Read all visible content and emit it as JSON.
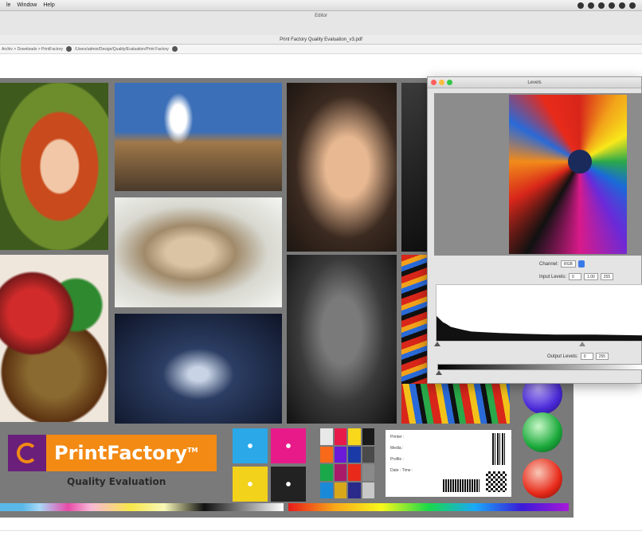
{
  "menubar": {
    "items": [
      "le",
      "Window",
      "Help"
    ]
  },
  "window": {
    "title_small": "Editor",
    "document_title": "Print Factory Quality Evaluation_v3.pdf"
  },
  "pathbar": {
    "left_path": "Archiv > Downloads > PrintFactory",
    "right_path": "/Users/admin/Design/Quality/Evaluation/Print Factory"
  },
  "chart_labels": {
    "brand": "PrintFactory",
    "trademark": "TM",
    "subtitle": "Quality Evaluation",
    "form_fields": [
      "Printer :",
      "Media :",
      "Profile :",
      "Date :",
      "Time :"
    ]
  },
  "levels": {
    "title": "Levels",
    "channel_label": "Channel:",
    "channel_value": "RGB",
    "input_label": "Input Levels:",
    "input_values": [
      "0",
      "1.00",
      "255"
    ],
    "output_label": "Output Levels:",
    "output_values": [
      "0",
      "255"
    ]
  },
  "colors": {
    "brand_orange": "#f28a14",
    "brand_purple": "#6a1f7a",
    "canvas_gray": "#7a7a7a"
  },
  "icons": [
    "apple-menu-icon",
    "status-icons",
    "traffic-light-icons"
  ]
}
